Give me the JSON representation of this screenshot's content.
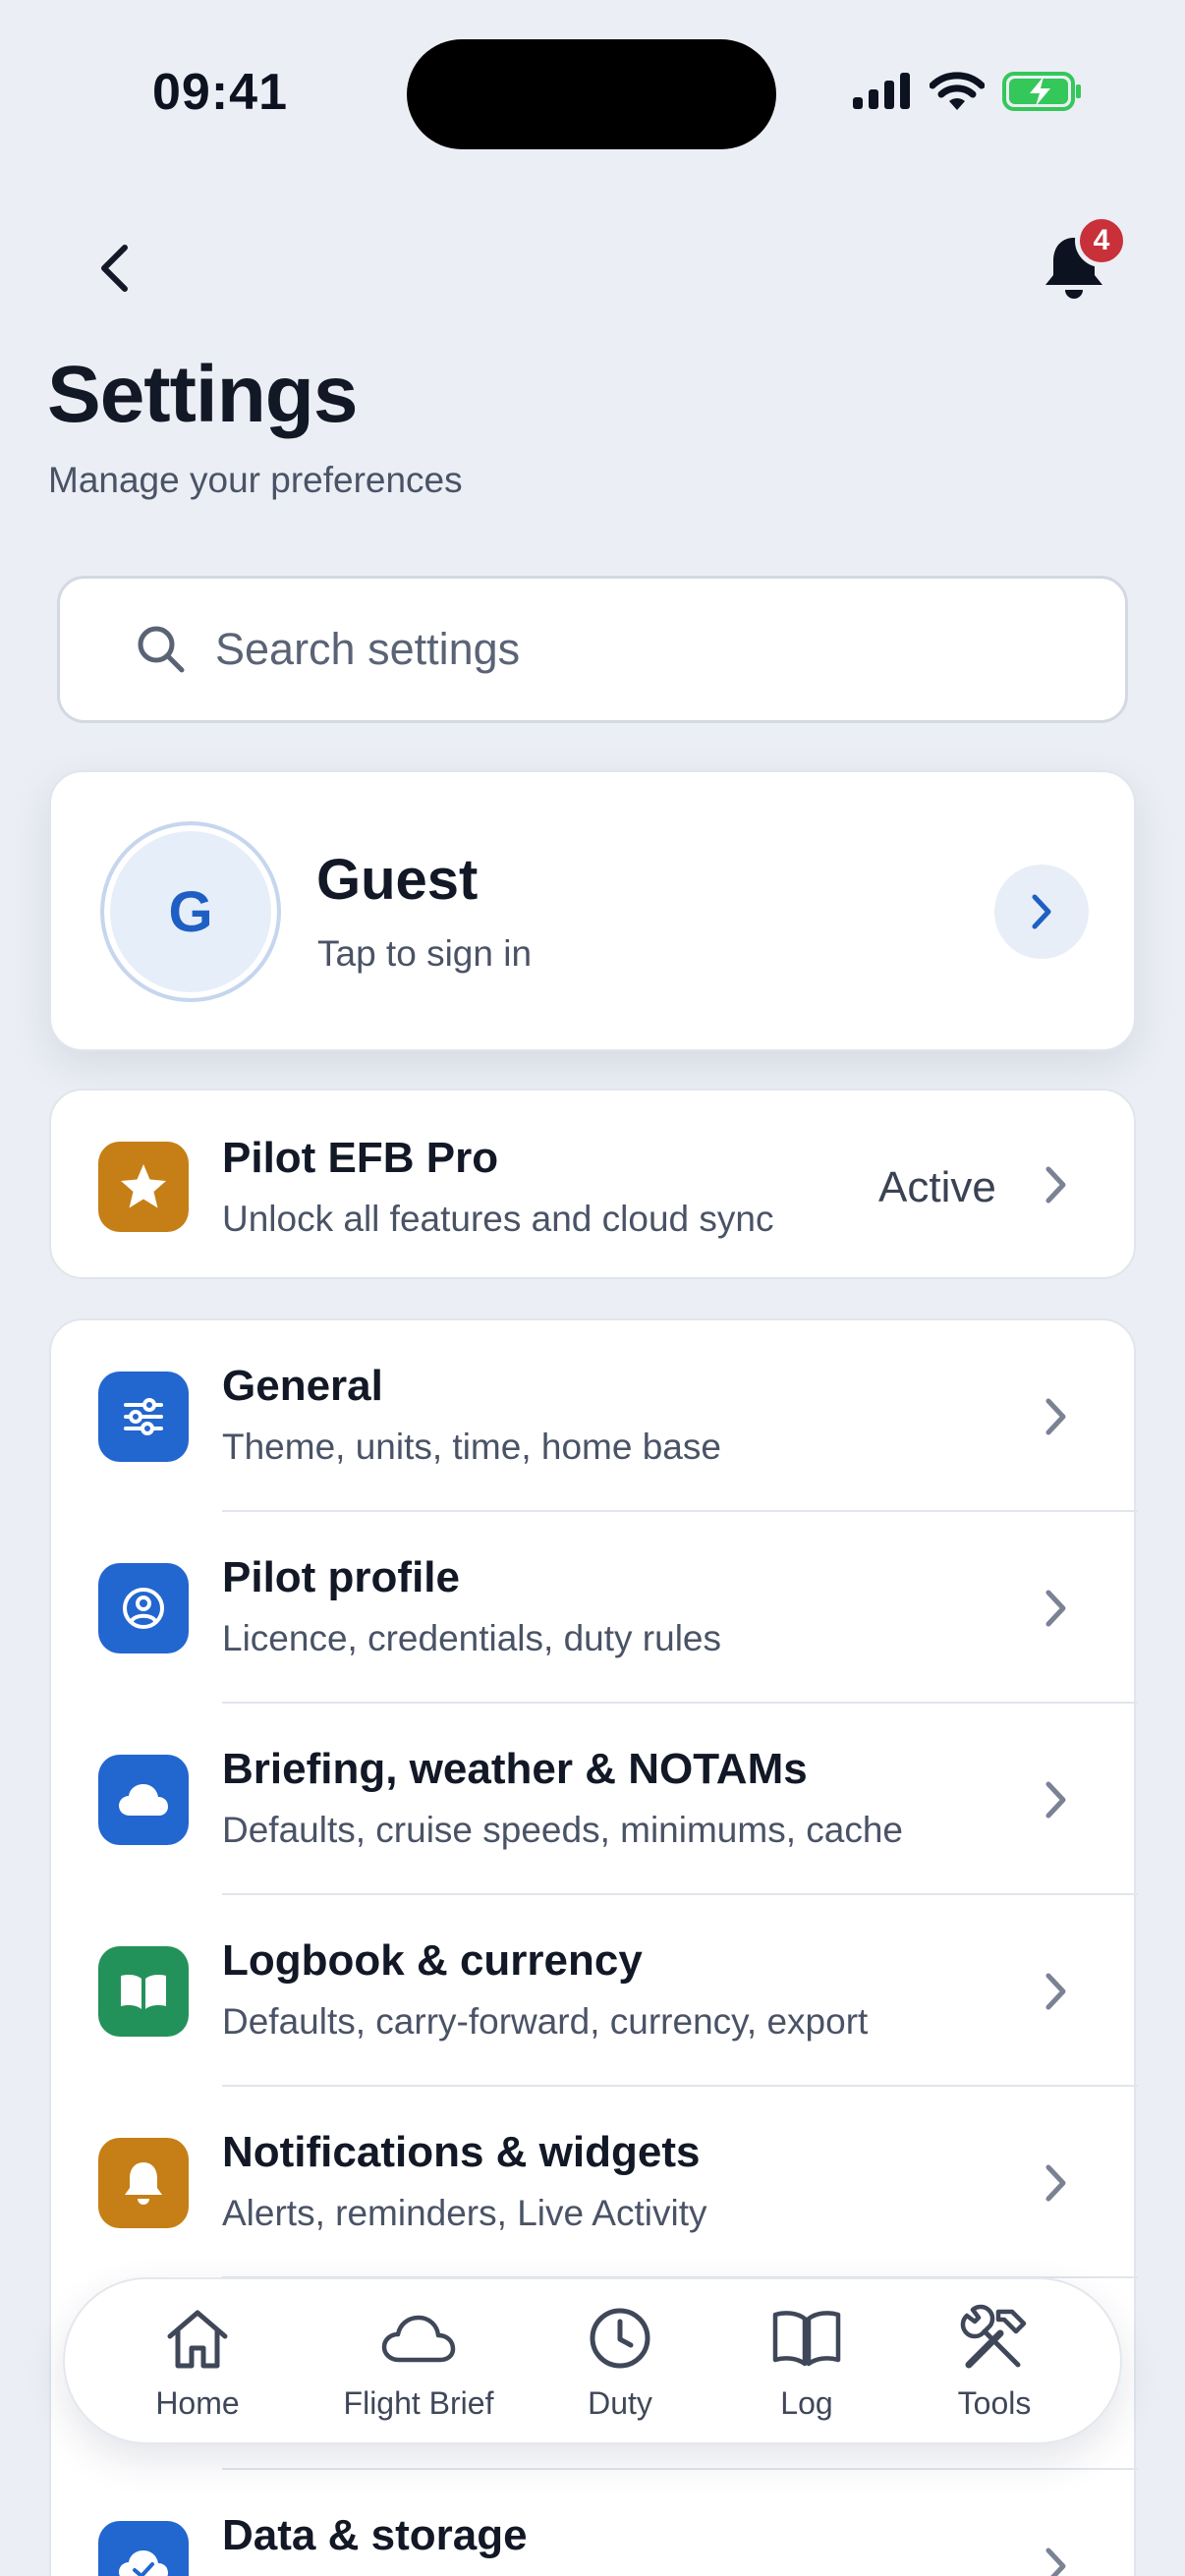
{
  "status_bar": {
    "time": "09:41"
  },
  "header": {
    "notification_count": "4",
    "title": "Settings",
    "subtitle": "Manage your preferences"
  },
  "search": {
    "placeholder": "Search settings"
  },
  "profile": {
    "initial": "G",
    "name": "Guest",
    "subtitle": "Tap to sign in"
  },
  "subscription": {
    "title": "Pilot EFB Pro",
    "subtitle": "Unlock all features and cloud sync",
    "status": "Active",
    "icon": "star-icon",
    "color": "#c57f16"
  },
  "settings_items": [
    {
      "title": "General",
      "subtitle": "Theme, units, time, home base",
      "icon": "sliders-icon",
      "color": "#2266d0"
    },
    {
      "title": "Pilot profile",
      "subtitle": "Licence, credentials, duty rules",
      "icon": "user-circle-icon",
      "color": "#2266d0"
    },
    {
      "title": "Briefing, weather & NOTAMs",
      "subtitle": "Defaults, cruise speeds, minimums, cache",
      "icon": "cloud-icon",
      "color": "#2266d0"
    },
    {
      "title": "Logbook & currency",
      "subtitle": "Defaults, carry-forward, currency, export",
      "icon": "book-icon",
      "color": "#23925a"
    },
    {
      "title": "Notifications & widgets",
      "subtitle": "Alerts, reminders, Live Activity",
      "icon": "bell-icon",
      "color": "#c57f16"
    },
    {
      "title": "",
      "subtitle": "",
      "icon": "",
      "color": ""
    },
    {
      "title": "Data & storage",
      "subtitle": "",
      "icon": "cloud-check-icon",
      "color": "#2266d0"
    }
  ],
  "tab_bar": [
    {
      "label": "Home",
      "icon": "home-icon"
    },
    {
      "label": "Flight Brief",
      "icon": "cloud-icon"
    },
    {
      "label": "Duty",
      "icon": "clock-icon"
    },
    {
      "label": "Log",
      "icon": "book-icon"
    },
    {
      "label": "Tools",
      "icon": "tools-icon"
    }
  ]
}
